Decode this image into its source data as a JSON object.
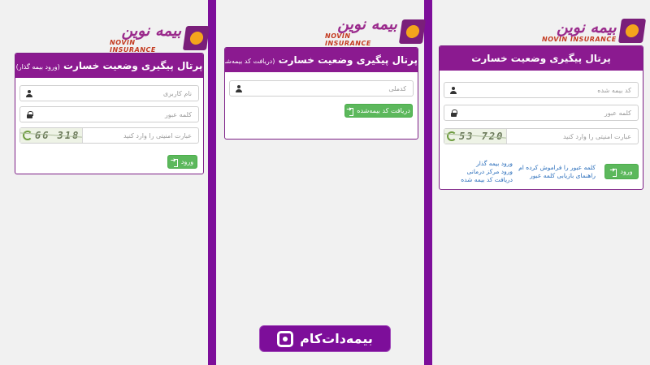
{
  "logo": {
    "name_fa": "بیمه نوین",
    "name_en": "NOVIN INSURANCE"
  },
  "panel1": {
    "title": "پرتال پیگیری وضعیت خسارت",
    "subtitle": "(ورود بیمه گذار)",
    "username_placeholder": "نام کاربری",
    "password_placeholder": "کلمه عبور",
    "captcha_code": "66 318",
    "captcha_placeholder": "عبارت امنیتی را وارد کنید",
    "login_label": "ورود"
  },
  "panel2": {
    "title": "پرتال پیگیری وضعیت خسارت",
    "subtitle": "(دریافت کد بیمه‌شده)",
    "national_code_placeholder": "کدملی",
    "get_code_label": "دریافت کد بیمه‌شده"
  },
  "panel3": {
    "title": "پرتال پیگیری وضعیت خسارت",
    "insured_code_placeholder": "کد بیمه شده",
    "password_placeholder": "کلمه عبور",
    "captcha_code": "53 720",
    "captcha_placeholder": "عبارت امنیتی را وارد کنید",
    "login_label": "ورود",
    "forgot_password": "کلمه عبور را فراموش کرده ام",
    "recovery_guide": "راهنمای بازیابی کلمه عبور",
    "policyholder_login": "ورود بیمه گذار",
    "center_login": "ورود مرکز درمانی",
    "get_insured_code": "دریافت کد بیمه شده"
  },
  "brand": {
    "name": "بیمه‌دات‌کام"
  },
  "colors": {
    "purple": "#7d0e9a",
    "header": "#8b1a90",
    "green": "#5cb85c",
    "link": "#2a6ebb"
  }
}
